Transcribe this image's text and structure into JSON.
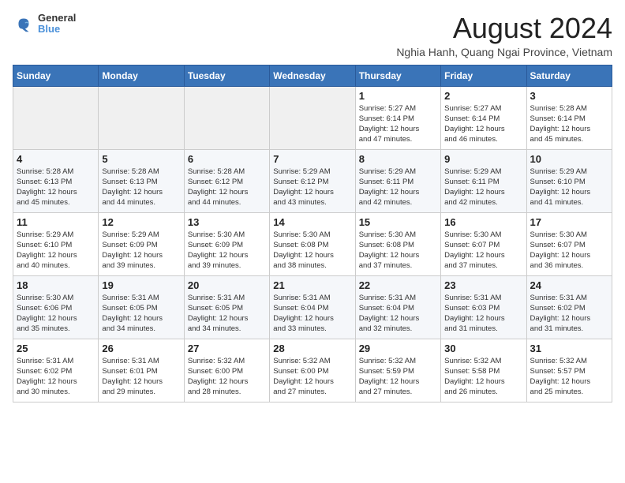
{
  "logo": {
    "line1": "General",
    "line2": "Blue"
  },
  "title": "August 2024",
  "subtitle": "Nghia Hanh, Quang Ngai Province, Vietnam",
  "days_of_week": [
    "Sunday",
    "Monday",
    "Tuesday",
    "Wednesday",
    "Thursday",
    "Friday",
    "Saturday"
  ],
  "weeks": [
    [
      {
        "day": "",
        "info": ""
      },
      {
        "day": "",
        "info": ""
      },
      {
        "day": "",
        "info": ""
      },
      {
        "day": "",
        "info": ""
      },
      {
        "day": "1",
        "info": "Sunrise: 5:27 AM\nSunset: 6:14 PM\nDaylight: 12 hours\nand 47 minutes."
      },
      {
        "day": "2",
        "info": "Sunrise: 5:27 AM\nSunset: 6:14 PM\nDaylight: 12 hours\nand 46 minutes."
      },
      {
        "day": "3",
        "info": "Sunrise: 5:28 AM\nSunset: 6:14 PM\nDaylight: 12 hours\nand 45 minutes."
      }
    ],
    [
      {
        "day": "4",
        "info": "Sunrise: 5:28 AM\nSunset: 6:13 PM\nDaylight: 12 hours\nand 45 minutes."
      },
      {
        "day": "5",
        "info": "Sunrise: 5:28 AM\nSunset: 6:13 PM\nDaylight: 12 hours\nand 44 minutes."
      },
      {
        "day": "6",
        "info": "Sunrise: 5:28 AM\nSunset: 6:12 PM\nDaylight: 12 hours\nand 44 minutes."
      },
      {
        "day": "7",
        "info": "Sunrise: 5:29 AM\nSunset: 6:12 PM\nDaylight: 12 hours\nand 43 minutes."
      },
      {
        "day": "8",
        "info": "Sunrise: 5:29 AM\nSunset: 6:11 PM\nDaylight: 12 hours\nand 42 minutes."
      },
      {
        "day": "9",
        "info": "Sunrise: 5:29 AM\nSunset: 6:11 PM\nDaylight: 12 hours\nand 42 minutes."
      },
      {
        "day": "10",
        "info": "Sunrise: 5:29 AM\nSunset: 6:10 PM\nDaylight: 12 hours\nand 41 minutes."
      }
    ],
    [
      {
        "day": "11",
        "info": "Sunrise: 5:29 AM\nSunset: 6:10 PM\nDaylight: 12 hours\nand 40 minutes."
      },
      {
        "day": "12",
        "info": "Sunrise: 5:29 AM\nSunset: 6:09 PM\nDaylight: 12 hours\nand 39 minutes."
      },
      {
        "day": "13",
        "info": "Sunrise: 5:30 AM\nSunset: 6:09 PM\nDaylight: 12 hours\nand 39 minutes."
      },
      {
        "day": "14",
        "info": "Sunrise: 5:30 AM\nSunset: 6:08 PM\nDaylight: 12 hours\nand 38 minutes."
      },
      {
        "day": "15",
        "info": "Sunrise: 5:30 AM\nSunset: 6:08 PM\nDaylight: 12 hours\nand 37 minutes."
      },
      {
        "day": "16",
        "info": "Sunrise: 5:30 AM\nSunset: 6:07 PM\nDaylight: 12 hours\nand 37 minutes."
      },
      {
        "day": "17",
        "info": "Sunrise: 5:30 AM\nSunset: 6:07 PM\nDaylight: 12 hours\nand 36 minutes."
      }
    ],
    [
      {
        "day": "18",
        "info": "Sunrise: 5:30 AM\nSunset: 6:06 PM\nDaylight: 12 hours\nand 35 minutes."
      },
      {
        "day": "19",
        "info": "Sunrise: 5:31 AM\nSunset: 6:05 PM\nDaylight: 12 hours\nand 34 minutes."
      },
      {
        "day": "20",
        "info": "Sunrise: 5:31 AM\nSunset: 6:05 PM\nDaylight: 12 hours\nand 34 minutes."
      },
      {
        "day": "21",
        "info": "Sunrise: 5:31 AM\nSunset: 6:04 PM\nDaylight: 12 hours\nand 33 minutes."
      },
      {
        "day": "22",
        "info": "Sunrise: 5:31 AM\nSunset: 6:04 PM\nDaylight: 12 hours\nand 32 minutes."
      },
      {
        "day": "23",
        "info": "Sunrise: 5:31 AM\nSunset: 6:03 PM\nDaylight: 12 hours\nand 31 minutes."
      },
      {
        "day": "24",
        "info": "Sunrise: 5:31 AM\nSunset: 6:02 PM\nDaylight: 12 hours\nand 31 minutes."
      }
    ],
    [
      {
        "day": "25",
        "info": "Sunrise: 5:31 AM\nSunset: 6:02 PM\nDaylight: 12 hours\nand 30 minutes."
      },
      {
        "day": "26",
        "info": "Sunrise: 5:31 AM\nSunset: 6:01 PM\nDaylight: 12 hours\nand 29 minutes."
      },
      {
        "day": "27",
        "info": "Sunrise: 5:32 AM\nSunset: 6:00 PM\nDaylight: 12 hours\nand 28 minutes."
      },
      {
        "day": "28",
        "info": "Sunrise: 5:32 AM\nSunset: 6:00 PM\nDaylight: 12 hours\nand 27 minutes."
      },
      {
        "day": "29",
        "info": "Sunrise: 5:32 AM\nSunset: 5:59 PM\nDaylight: 12 hours\nand 27 minutes."
      },
      {
        "day": "30",
        "info": "Sunrise: 5:32 AM\nSunset: 5:58 PM\nDaylight: 12 hours\nand 26 minutes."
      },
      {
        "day": "31",
        "info": "Sunrise: 5:32 AM\nSunset: 5:57 PM\nDaylight: 12 hours\nand 25 minutes."
      }
    ]
  ]
}
